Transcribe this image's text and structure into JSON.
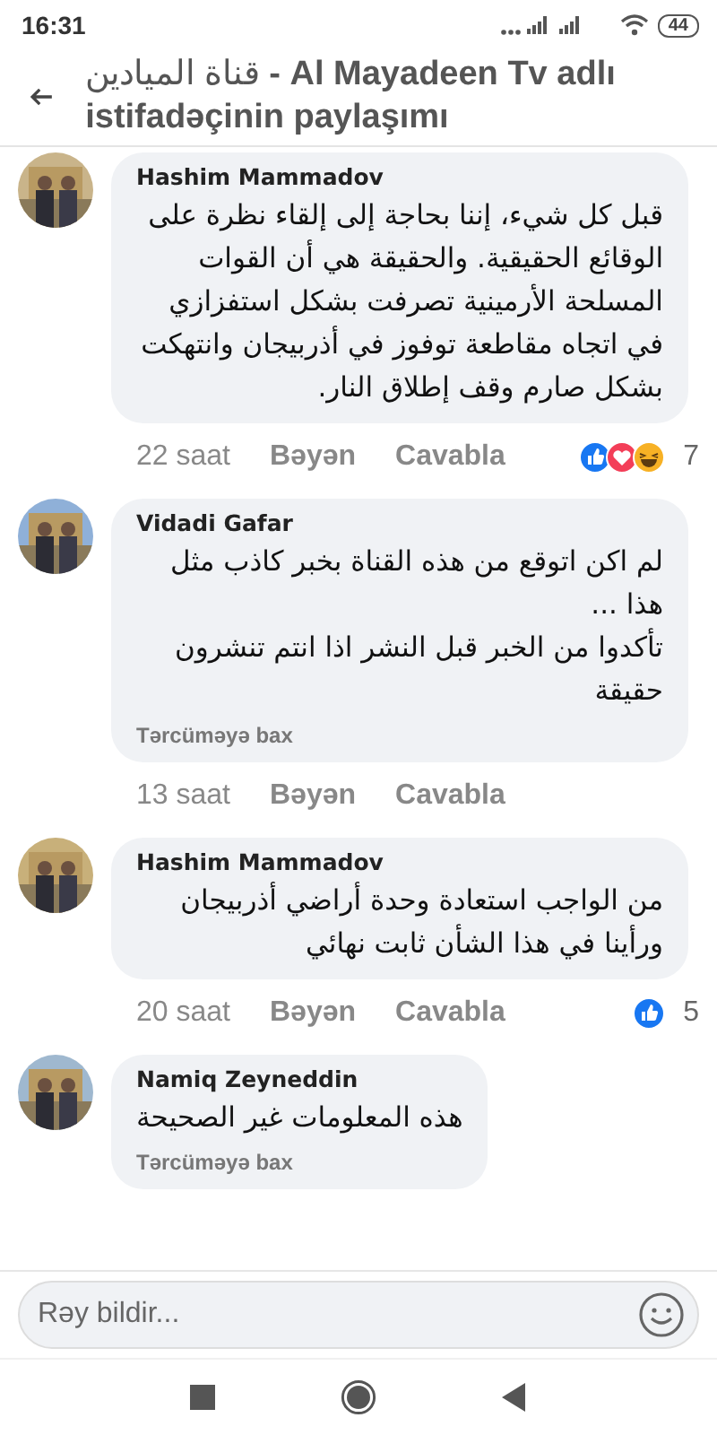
{
  "status_bar": {
    "time": "16:31",
    "battery": "44"
  },
  "header": {
    "title": "قناة الميادين **- Al Mayadeen Tv adlı istifadəçinin paylaşımı**"
  },
  "comments": [
    {
      "name": "Hashim Mammadov",
      "text": "قبل كل شيء، إننا بحاجة إلى إلقاء نظرة على الوقائع الحقيقية. والحقيقة هي أن القوات المسلحة الأرمينية تصرفت بشكل استفزازي في اتجاه مقاطعة توفوز في أذربيجان وانتهكت بشكل صارم وقف إطلاق النار.",
      "time": "22 saat",
      "like_label": "Bəyən",
      "reply_label": "Cavabla",
      "reactions": [
        {
          "kind": "like"
        },
        {
          "kind": "love"
        },
        {
          "kind": "haha"
        }
      ],
      "reaction_count": "7"
    },
    {
      "name": "Vidadi Gafar",
      "text": "لم اكن اتوقع من هذه القناة بخبر كاذب مثل هذا ...\nتأكدوا من الخبر قبل النشر اذا انتم تنشرون حقيقة",
      "translate": "Tərcüməyə bax",
      "time": "13 saat",
      "like_label": "Bəyən",
      "reply_label": "Cavabla"
    },
    {
      "name": "Hashim Mammadov",
      "text": "من الواجب استعادة وحدة أراضي أذربيجان ورأينا في هذا الشأن ثابت نهائي",
      "time": "20 saat",
      "like_label": "Bəyən",
      "reply_label": "Cavabla",
      "reactions": [
        {
          "kind": "like"
        }
      ],
      "reaction_count": "5"
    },
    {
      "name": "Namiq Zeyneddin",
      "text": "هذه المعلومات غير الصحيحة",
      "translate": "Tərcüməyə bax"
    }
  ],
  "composer": {
    "placeholder": "Rəy bildir..."
  }
}
